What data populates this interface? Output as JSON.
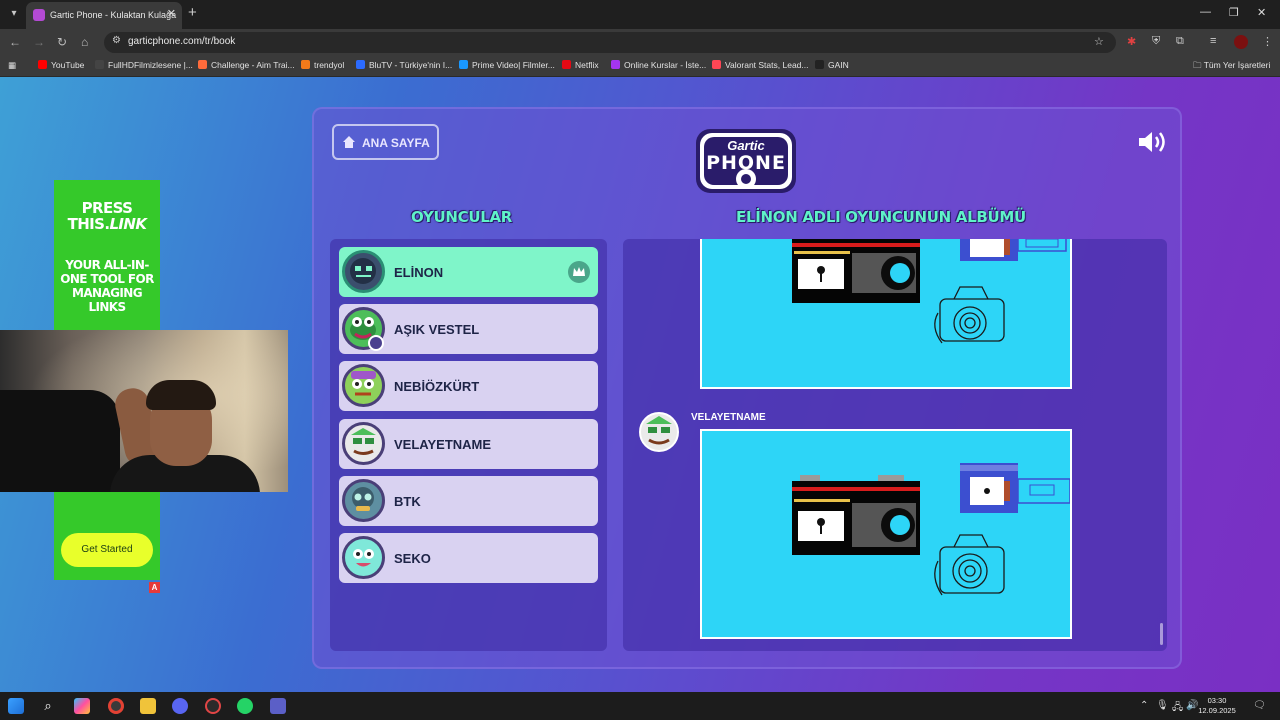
{
  "browser": {
    "tab_title": "Gartic Phone - Kulaktan Kulağa",
    "url": "garticphone.com/tr/book",
    "bookmarks": [
      {
        "label": "YouTube",
        "color": "#ff0000"
      },
      {
        "label": "FullHDFilmizlesene |...",
        "color": "#444444"
      },
      {
        "label": "Challenge - Aim Trai...",
        "color": "#ff6b3b"
      },
      {
        "label": "trendyol",
        "color": "#f27a1a"
      },
      {
        "label": "BluTV - Türkiye'nin I...",
        "color": "#2c6bff"
      },
      {
        "label": "Prime Video| Filmler...",
        "color": "#1a98ff"
      },
      {
        "label": "Netflix",
        "color": "#e50914"
      },
      {
        "label": "Online Kurslar - İste...",
        "color": "#a435f0"
      },
      {
        "label": "Valorant Stats, Lead...",
        "color": "#ff4655"
      },
      {
        "label": "GAIN",
        "color": "#222222"
      }
    ],
    "all_bookmarks": "Tüm Yer İşaretleri"
  },
  "ad": {
    "headline_1": "PRESS",
    "headline_2": "THIS.",
    "headline_3": "LINK",
    "subline": "YOUR ALL-IN-ONE TOOL FOR MANAGING LINKS",
    "cta": "Get Started",
    "badge": "A"
  },
  "game": {
    "home_button": "ANA SAYFA",
    "logo_line1": "Gartic",
    "logo_line2": "PHONE",
    "players_title": "OYUNCULAR",
    "album_title": "ELİNON ADLI OYUNCUNUN ALBÜMÜ",
    "players": [
      {
        "name": "ELİNON",
        "avatar_color": "#3b4f6d",
        "active": true,
        "crown": true
      },
      {
        "name": "AŞIK VESTEL",
        "avatar_color": "#4dbe5a",
        "active": false,
        "crown": false
      },
      {
        "name": "NEBİÖZKÜRT",
        "avatar_color": "#8ed15a",
        "active": false,
        "crown": false
      },
      {
        "name": "VELAYETNAME",
        "avatar_color": "#e9e9e9",
        "active": false,
        "crown": false
      },
      {
        "name": "BTK",
        "avatar_color": "#5e8fa1",
        "active": false,
        "crown": false
      },
      {
        "name": "SEKO",
        "avatar_color": "#7fe8d9",
        "active": false,
        "crown": false
      }
    ],
    "album_author": "VELAYETNAME"
  },
  "colors": {
    "accent_mint": "#7ff5c9",
    "title_mint": "#5ff3c8",
    "drawing_bg": "#2dd5f7"
  },
  "taskbar": {
    "time": "03:30",
    "date": "12.09.2025"
  }
}
